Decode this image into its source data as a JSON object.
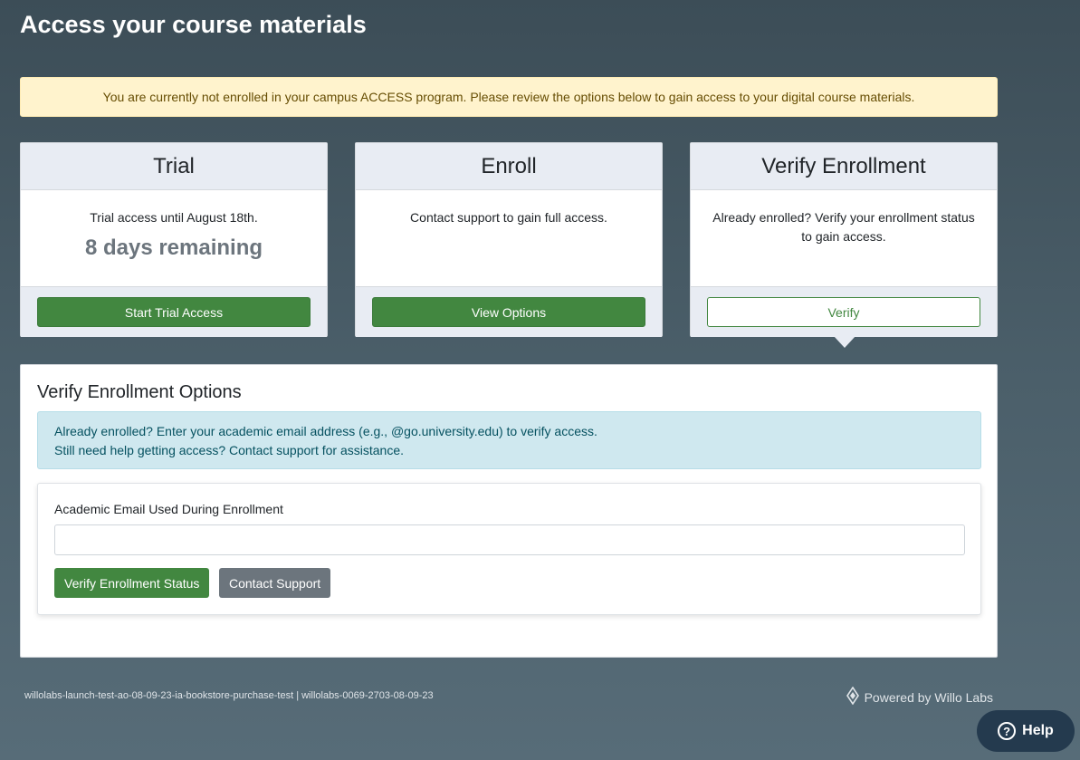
{
  "page": {
    "title": "Access your course materials"
  },
  "notice": {
    "text": "You are currently not enrolled in your campus ACCESS program. Please review the options below to gain access to your digital course materials."
  },
  "cards": {
    "trial": {
      "header": "Trial",
      "text": "Trial access until August 18th.",
      "remaining": "8 days remaining",
      "button": "Start Trial Access"
    },
    "enroll": {
      "header": "Enroll",
      "text": "Contact support to gain full access.",
      "button": "View Options"
    },
    "verify": {
      "header": "Verify Enrollment",
      "text": "Already enrolled? Verify your enrollment status to gain access.",
      "button": "Verify"
    }
  },
  "verify_panel": {
    "title": "Verify Enrollment Options",
    "info_line1": "Already enrolled? Enter your academic email address (e.g., @go.university.edu) to verify access.",
    "info_line2": "Still need help getting access? Contact support for assistance.",
    "email_label": "Academic Email Used During Enrollment",
    "email_value": "",
    "verify_button": "Verify Enrollment Status",
    "support_button": "Contact Support"
  },
  "footer": {
    "identifier": "willolabs-launch-test-ao-08-09-23-ia-bookstore-purchase-test | willolabs-0069-2703-08-09-23",
    "powered_by": "Powered by Willo Labs",
    "logo_icon": "willo-labs-logo-icon"
  },
  "help": {
    "label": "Help",
    "icon": "question-circle-icon"
  },
  "colors": {
    "primary_green": "#428740",
    "secondary_gray": "#6c757d",
    "warning_bg": "#fff3cd",
    "info_bg": "#cfe8ef",
    "help_bg": "#243a4e"
  }
}
